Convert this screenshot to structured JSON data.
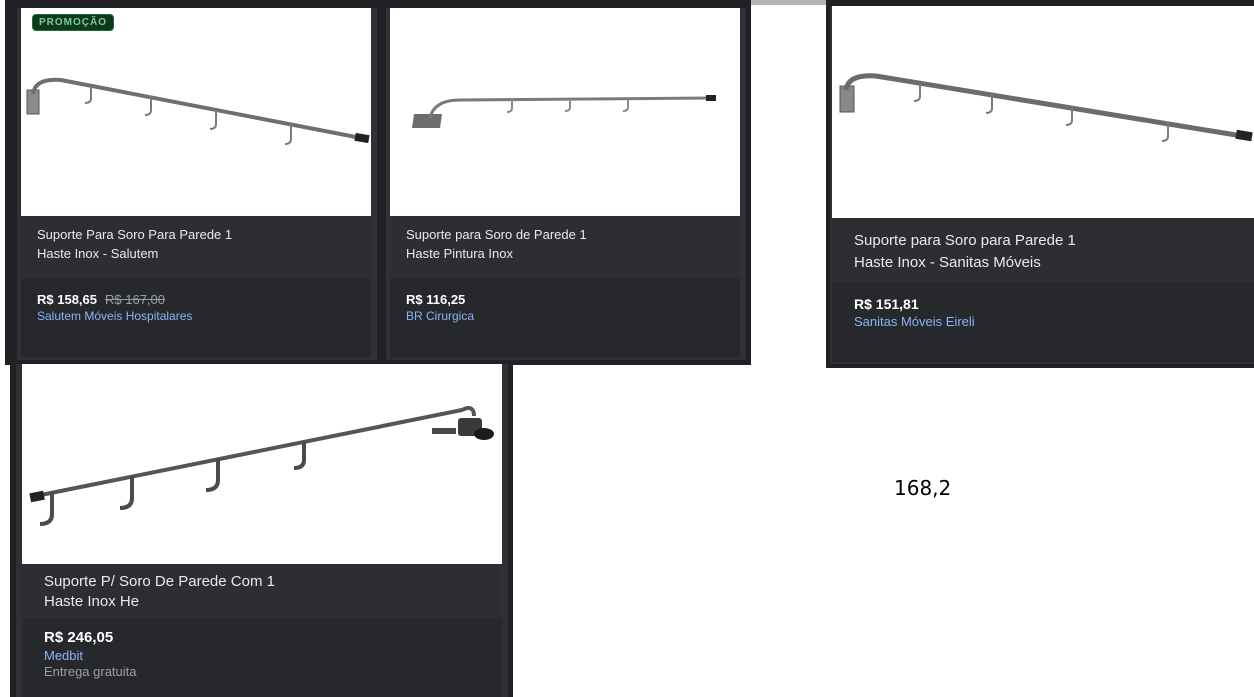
{
  "annotation": "168,2",
  "cards": [
    {
      "badge": "PROMOÇÃO",
      "title_line1": "Suporte Para Soro Para Parede 1",
      "title_line2": "Haste Inox - Salutem",
      "price": "R$ 158,65",
      "old_price": "R$ 167,00",
      "seller": "Salutem Móveis Hospitalares",
      "image_icon": "iv-pole-wall-mount"
    },
    {
      "title_line1": "Suporte para Soro de Parede 1",
      "title_line2": "Haste Pintura Inox",
      "price": "R$ 116,25",
      "seller": "BR Cirurgica",
      "image_icon": "iv-pole-wall-mount"
    },
    {
      "title_line1": "Suporte para Soro para Parede 1",
      "title_line2": "Haste Inox - Sanitas Móveis",
      "price": "R$ 151,81",
      "seller": "Sanitas Móveis Eireli",
      "image_icon": "iv-pole-wall-mount"
    },
    {
      "title_line1": "Suporte P/ Soro De Parede Com 1",
      "title_line2": "Haste Inox He",
      "price": "R$ 246,05",
      "seller": "Medbit",
      "shipping": "Entrega gratuita",
      "image_icon": "iv-pole-wall-mount"
    }
  ]
}
